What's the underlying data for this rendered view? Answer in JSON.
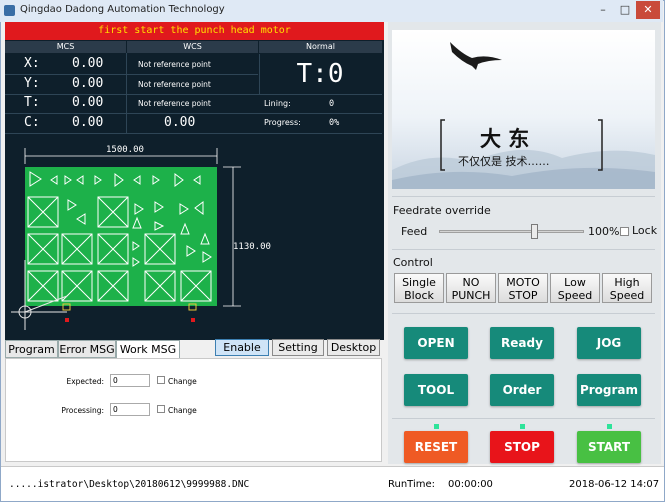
{
  "window": {
    "title": "Qingdao Dadong Automation Technology",
    "min": "–",
    "max": "□",
    "close": "✕"
  },
  "status_message": "first start the punch head motor",
  "coords": {
    "col_mcs": "MCS",
    "col_wcs": "WCS",
    "mode": "Normal",
    "rows": [
      {
        "axis": "X:",
        "mcs": "0.00",
        "wcs": "Not reference point"
      },
      {
        "axis": "Y:",
        "mcs": "0.00",
        "wcs": "Not reference point"
      },
      {
        "axis": "T:",
        "mcs": "0.00",
        "wcs": "Not reference point"
      },
      {
        "axis": "C:",
        "mcs": "0.00",
        "wcs": "0.00"
      }
    ]
  },
  "tool": {
    "display": "T:0"
  },
  "stats": {
    "lining_label": "Lining:",
    "lining_value": "0",
    "progress_label": "Progress:",
    "progress_value": "0%"
  },
  "graphic": {
    "width_dim": "1500.00",
    "height_dim": "1130.00"
  },
  "tabs": [
    "Program",
    "Error MSG",
    "Work MSG"
  ],
  "view_buttons": [
    "Enable",
    "Setting",
    "Desktop"
  ],
  "work_msg": {
    "expected_label": "Expected:",
    "expected_value": "0",
    "expected_change": "Change",
    "processing_label": "Processing:",
    "processing_value": "0",
    "processing_change": "Change"
  },
  "banner": {
    "logo_main": "大 东",
    "logo_sub": "不仅仅是 技术……"
  },
  "feedrate": {
    "section": "Feedrate override",
    "label": "Feed",
    "value_percent": 100,
    "value_text": "100%",
    "lock_label": "Lock"
  },
  "control": {
    "section": "Control",
    "buttons": [
      "Single Block",
      "NO PUNCH",
      "MOTO STOP",
      "Low Speed",
      "High Speed"
    ]
  },
  "ops": {
    "row1": [
      "OPEN",
      "Ready",
      "JOG"
    ],
    "row2": [
      "TOOL",
      "Order",
      "Program"
    ],
    "row3": [
      "RESET",
      "STOP",
      "START"
    ]
  },
  "colors": {
    "teal": "#168a7a",
    "reset": "#ef5a24",
    "stop": "#e8141a",
    "start": "#48c043",
    "sheet": "#1db14a",
    "alarm_red": "#e0191d"
  },
  "footer": {
    "path": ".....istrator\\Desktop\\20180612\\9999988.DNC",
    "runtime_label": "RunTime:",
    "runtime_value": "00:00:00",
    "datetime": "2018-06-12 14:07"
  }
}
